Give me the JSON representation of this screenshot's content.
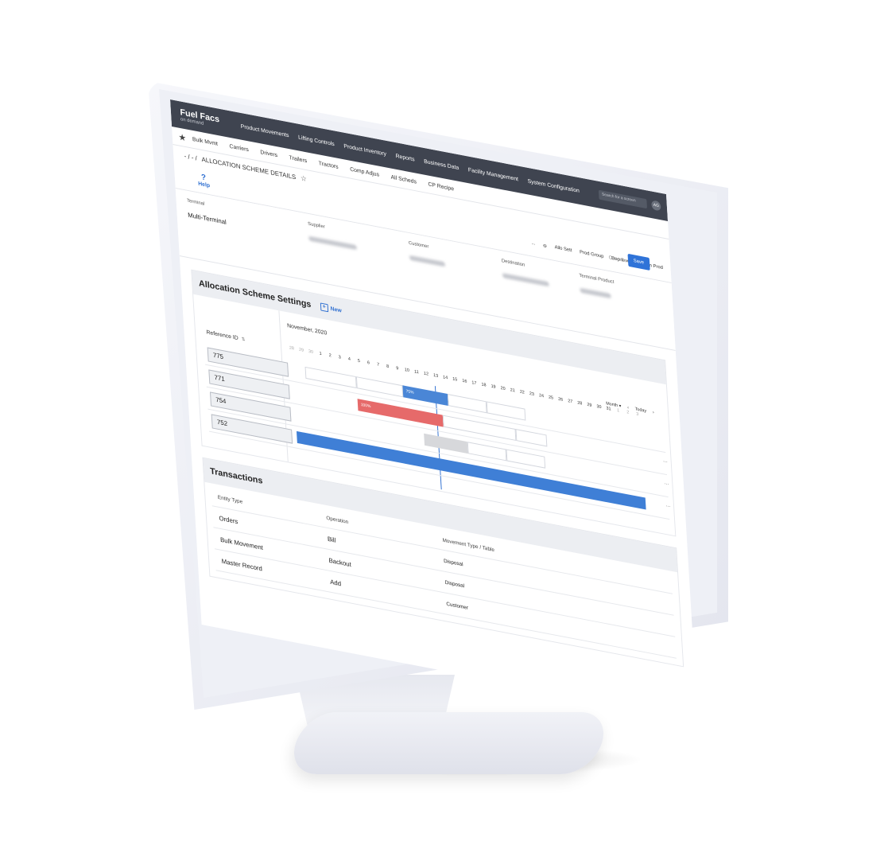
{
  "app": {
    "name": "Fuel Facs",
    "subtitle": "on demand"
  },
  "top_nav": [
    "Product Movements",
    "Lifting Controls",
    "Product Inventory",
    "Reports",
    "Business Data",
    "Facility Management",
    "System Configuration"
  ],
  "search": {
    "placeholder": "Search for a screen"
  },
  "user": {
    "initials": "AG"
  },
  "sub_nav": [
    "Bulk Mvmt",
    "Carriers",
    "Drivers",
    "Trailers",
    "Tractors",
    "Comp Adjus",
    "All Scheds",
    "CP Recipe"
  ],
  "breadcrumb": {
    "path": "- / - /",
    "title": "ALLOCATION SCHEME DETAILS"
  },
  "toolbar": {
    "help": "Help",
    "more": "...",
    "items": [
      "Allo Sett",
      "Prod Group",
      "Dep levers",
      "Term Prod"
    ],
    "more_right": "..."
  },
  "header": {
    "terminal_label": "Terminal",
    "terminal_value": "Multi-Terminal",
    "supplier_label": "Supplier",
    "customer_label": "Customer",
    "destination_label": "Destination",
    "terminal_product_label": "Terminal Product",
    "cancel": "Cancel",
    "save": "Save"
  },
  "allocation": {
    "title": "Allocation Scheme Settings",
    "new_label": "New",
    "ref_header": "Reference ID",
    "month": "November, 2020",
    "view": "Month",
    "today": "Today",
    "days_prev": [
      "28",
      "29",
      "30"
    ],
    "days": [
      "1",
      "2",
      "3",
      "4",
      "5",
      "6",
      "7",
      "8",
      "9",
      "10",
      "11",
      "12",
      "13",
      "14",
      "15",
      "16",
      "17",
      "18",
      "19",
      "20",
      "21",
      "22",
      "23",
      "24",
      "25",
      "26",
      "27",
      "28",
      "29",
      "30",
      "31"
    ],
    "days_next": [
      "1",
      "2",
      "3"
    ],
    "rows": [
      {
        "id": "775",
        "bar_label": "75%",
        "color": "#4a86d6"
      },
      {
        "id": "771",
        "bar_label": "100%",
        "color": "#e66a6a"
      },
      {
        "id": "754",
        "bar_label": "",
        "color": "#d7d8db"
      },
      {
        "id": "752",
        "bar_label": "",
        "color": "#3f7fd6"
      }
    ]
  },
  "transactions": {
    "title": "Transactions",
    "columns": [
      "Entity Type",
      "Operation",
      "Movement Type / Table"
    ],
    "rows": [
      {
        "entity": "Orders",
        "operation": "Bill",
        "movement": "Disposal"
      },
      {
        "entity": "Bulk Movement",
        "operation": "Backout",
        "movement": "Disposal"
      },
      {
        "entity": "Master Record",
        "operation": "Add",
        "movement": "Customer"
      }
    ]
  },
  "colors": {
    "topbar": "#3f4450",
    "accent": "#2f73d8",
    "bezel": "#eef0f6"
  }
}
